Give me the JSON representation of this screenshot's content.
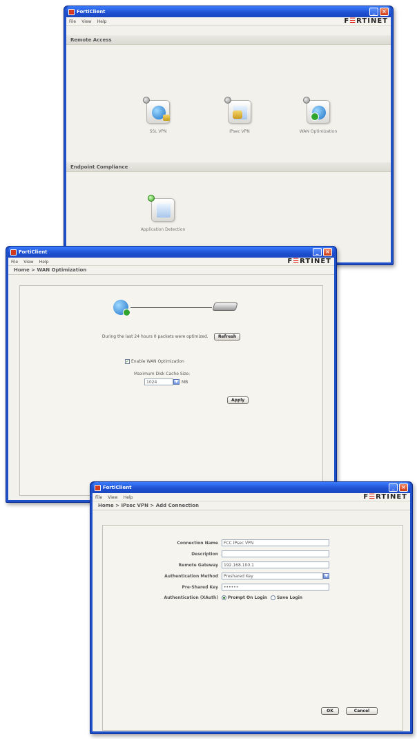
{
  "window1": {
    "title": "FortiClient",
    "menu": [
      "File",
      "View",
      "Help"
    ],
    "logo": "F≡RTINET",
    "sections": [
      {
        "title": "Remote Access",
        "tiles": [
          {
            "label": "SSL VPN",
            "icon": "ssl-vpn-icon"
          },
          {
            "label": "IPsec VPN",
            "icon": "ipsec-vpn-icon"
          },
          {
            "label": "WAN Optimization",
            "icon": "wan-optimization-icon"
          }
        ]
      },
      {
        "title": "Endpoint Compliance",
        "tiles": [
          {
            "label": "Application Detection",
            "icon": "application-detection-icon"
          }
        ]
      }
    ]
  },
  "window2": {
    "title": "FortiClient",
    "menu": [
      "File",
      "View",
      "Help"
    ],
    "logo": "F≡RTINET",
    "breadcrumb": "Home  >  WAN Optimization",
    "status_text": "During the last 24 hours 0 packets were optimized.",
    "refresh_label": "Refresh",
    "enable_label": "Enable WAN Optimization",
    "enable_checked": true,
    "cache_label": "Maximum Disk Cache Size:",
    "cache_value": "1024",
    "cache_unit": "MB",
    "apply_label": "Apply"
  },
  "window3": {
    "title": "FortiClient",
    "menu": [
      "File",
      "View",
      "Help"
    ],
    "logo": "F≡RTINET",
    "breadcrumb": "Home  >  IPsec VPN  >  Add Connection",
    "fields": {
      "connection_name_label": "Connection Name",
      "connection_name_value": "FCC IPsec VPN",
      "description_label": "Description",
      "description_value": "",
      "remote_gateway_label": "Remote Gateway",
      "remote_gateway_value": "192.168.100.1",
      "auth_method_label": "Authentication Method",
      "auth_method_value": "Preshared Key",
      "psk_label": "Pre-Shared Key",
      "psk_value": "••••••",
      "xauth_label": "Authentication (XAuth)",
      "xauth_option1": "Prompt On Login",
      "xauth_option2": "Save Login"
    },
    "ok_label": "OK",
    "cancel_label": "Cancel"
  }
}
